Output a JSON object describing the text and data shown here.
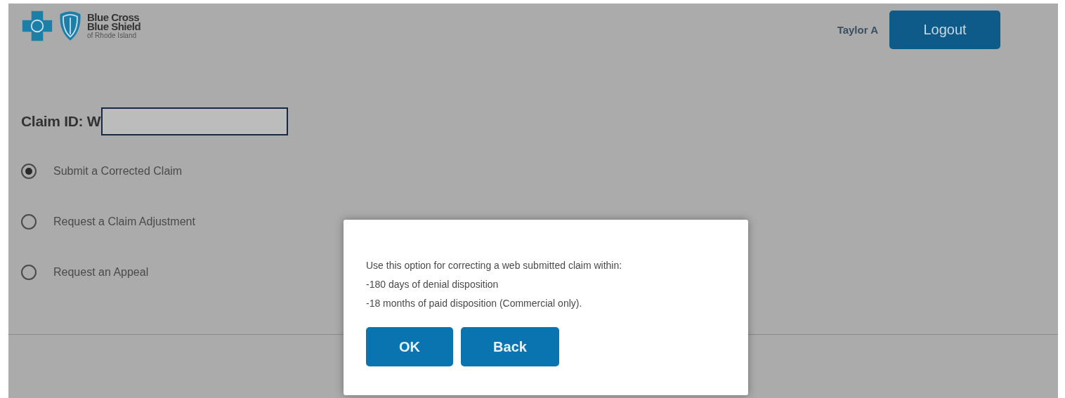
{
  "header": {
    "logo": {
      "line_1": "Blue Cross",
      "line_2": "Blue Shield",
      "line_3": "of Rhode Island"
    },
    "user_name": "Taylor A",
    "logout_button": "Logout"
  },
  "claim": {
    "label": "Claim ID: W"
  },
  "options": [
    {
      "label": "Submit a Corrected Claim",
      "selected": true
    },
    {
      "label": "Request a Claim Adjustment",
      "selected": false
    },
    {
      "label": "Request an Appeal",
      "selected": false
    }
  ],
  "dialog": {
    "lines": [
      "Use this option for correcting a web submitted claim within:",
      "-180 days of denial disposition",
      "-18 months of paid disposition (Commercial only)."
    ],
    "buttons": [
      "OK",
      "Back"
    ]
  }
}
